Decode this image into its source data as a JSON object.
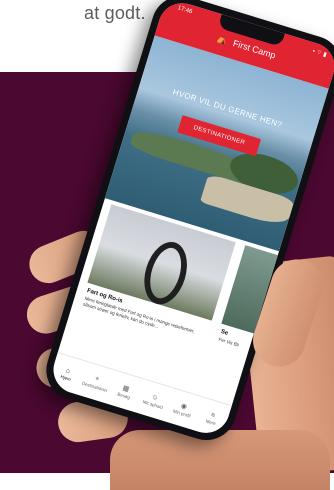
{
  "background": {
    "top_text": "at godt.",
    "maroon": "#4b0830"
  },
  "status": {
    "time": "17:46",
    "icons": "▪ ⌔ ▮"
  },
  "header": {
    "brand": "First Camp",
    "brand_icon": "tent-icon",
    "color": "#e02432"
  },
  "hero": {
    "title": "HVOR VIL DU GERNE HEN?",
    "cta": "DESTINATIONER"
  },
  "cards": [
    {
      "title": "Fart og Ro-is",
      "desc": "Mere ferieglæde med Fart og Ro-is i mange rejseformer, såsom strøer og ferieliv, kan du nyde..."
    },
    {
      "title": "Se",
      "desc": "Fer Vis Bli"
    }
  ],
  "tabs": [
    {
      "label": "Hjem",
      "icon": "home-icon",
      "active": true
    },
    {
      "label": "Destinationer",
      "icon": "map-pin-icon",
      "active": false
    },
    {
      "label": "Besøg",
      "icon": "calendar-icon",
      "active": false
    },
    {
      "label": "Mit ophold",
      "icon": "user-icon",
      "active": false
    },
    {
      "label": "Min profil",
      "icon": "profile-icon",
      "active": false
    },
    {
      "label": "Mere",
      "icon": "menu-icon",
      "active": false
    }
  ]
}
